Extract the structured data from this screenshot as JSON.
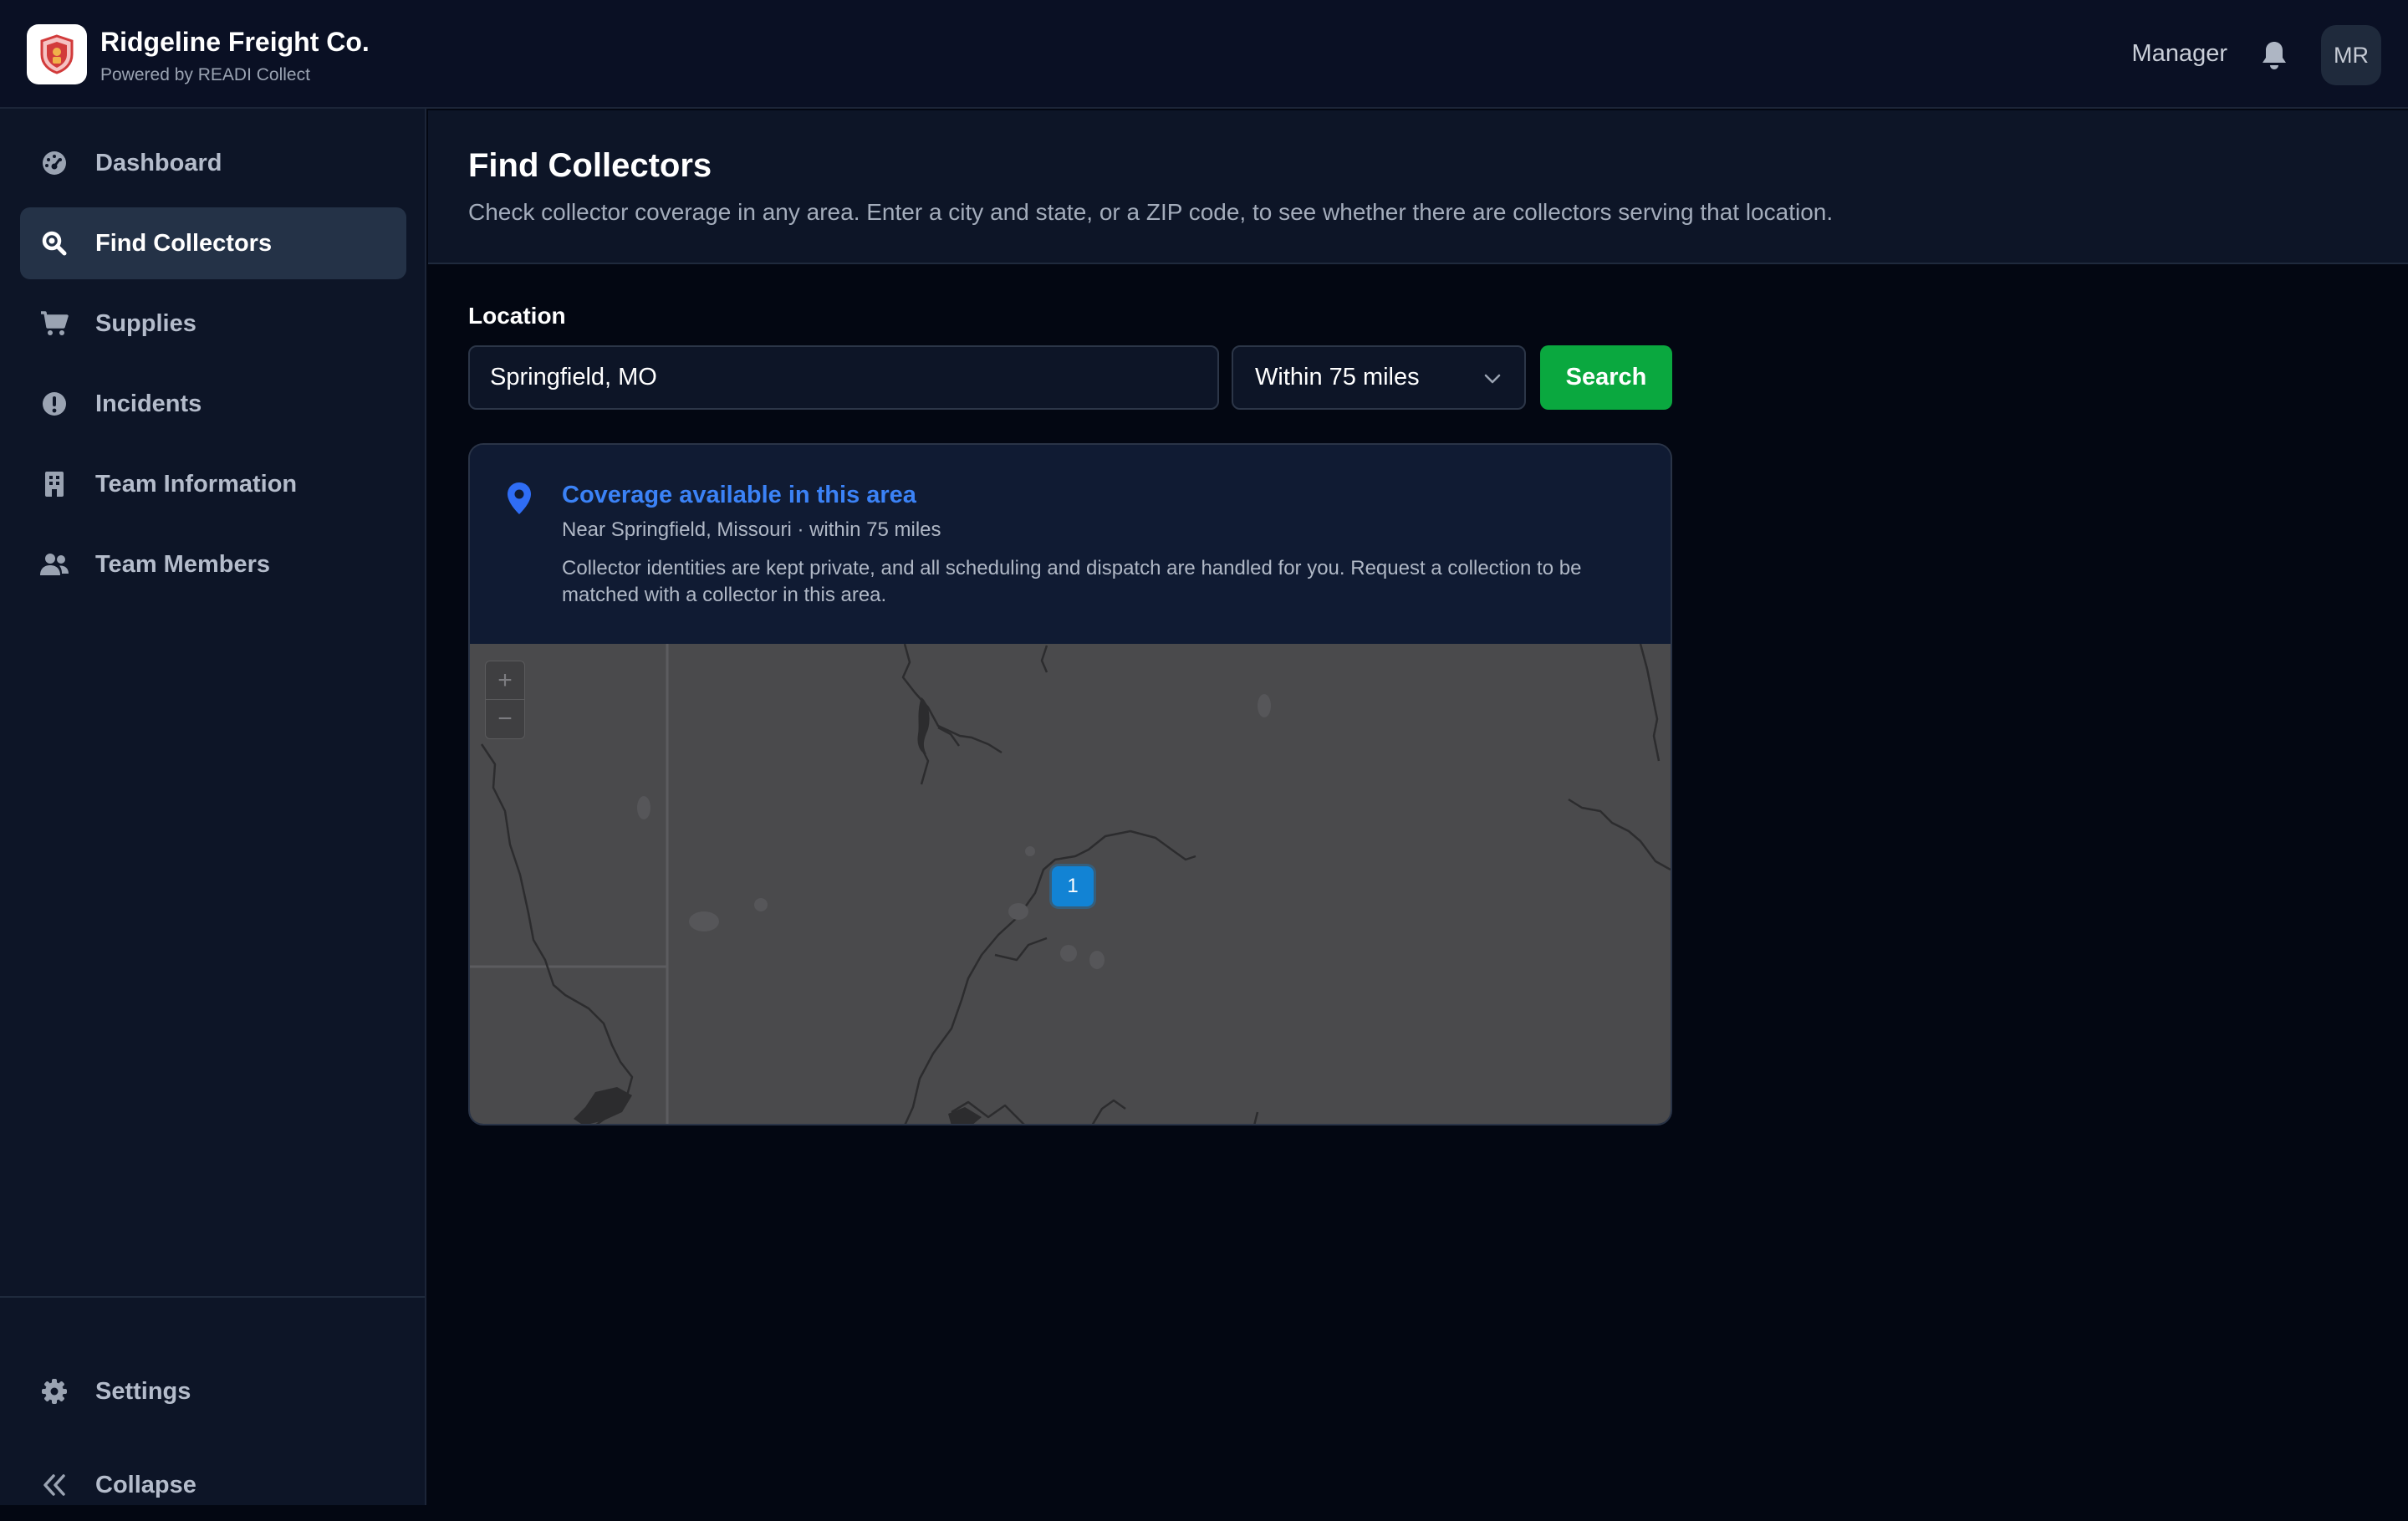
{
  "header": {
    "brand_name": "Ridgeline Freight Co.",
    "brand_sub": "Powered by READI Collect",
    "role": "Manager",
    "avatar_initials": "MR"
  },
  "sidebar": {
    "items": [
      {
        "label": "Dashboard",
        "icon": "dashboard-gauge-icon"
      },
      {
        "label": "Find Collectors",
        "icon": "search-icon",
        "active": true
      },
      {
        "label": "Supplies",
        "icon": "cart-icon"
      },
      {
        "label": "Incidents",
        "icon": "alert-icon"
      },
      {
        "label": "Team Information",
        "icon": "building-icon"
      },
      {
        "label": "Team Members",
        "icon": "users-icon"
      }
    ],
    "bottom": [
      {
        "label": "Settings",
        "icon": "gear-icon"
      },
      {
        "label": "Collapse",
        "icon": "double-chevron-left-icon"
      }
    ]
  },
  "main": {
    "title": "Find Collectors",
    "description": "Check collector coverage in any area. Enter a city and state, or a ZIP code, to see whether there are collectors serving that location.",
    "location_label": "Location",
    "location_value": "Springfield, MO",
    "radius_selected": "Within 75 miles",
    "search_label": "Search"
  },
  "result": {
    "title": "Coverage available in this area",
    "subtitle": "Near Springfield, Missouri · within 75 miles",
    "note": "Collector identities are kept private, and all scheduling and dispatch are handled for you. Request a collection to be matched with a collector in this area."
  },
  "map": {
    "zoom_in": "+",
    "zoom_out": "−",
    "cluster_count": "1"
  },
  "colors": {
    "accent_green": "#0aa83f",
    "accent_blue": "#3b82f6",
    "cluster_blue": "#1283d4"
  }
}
